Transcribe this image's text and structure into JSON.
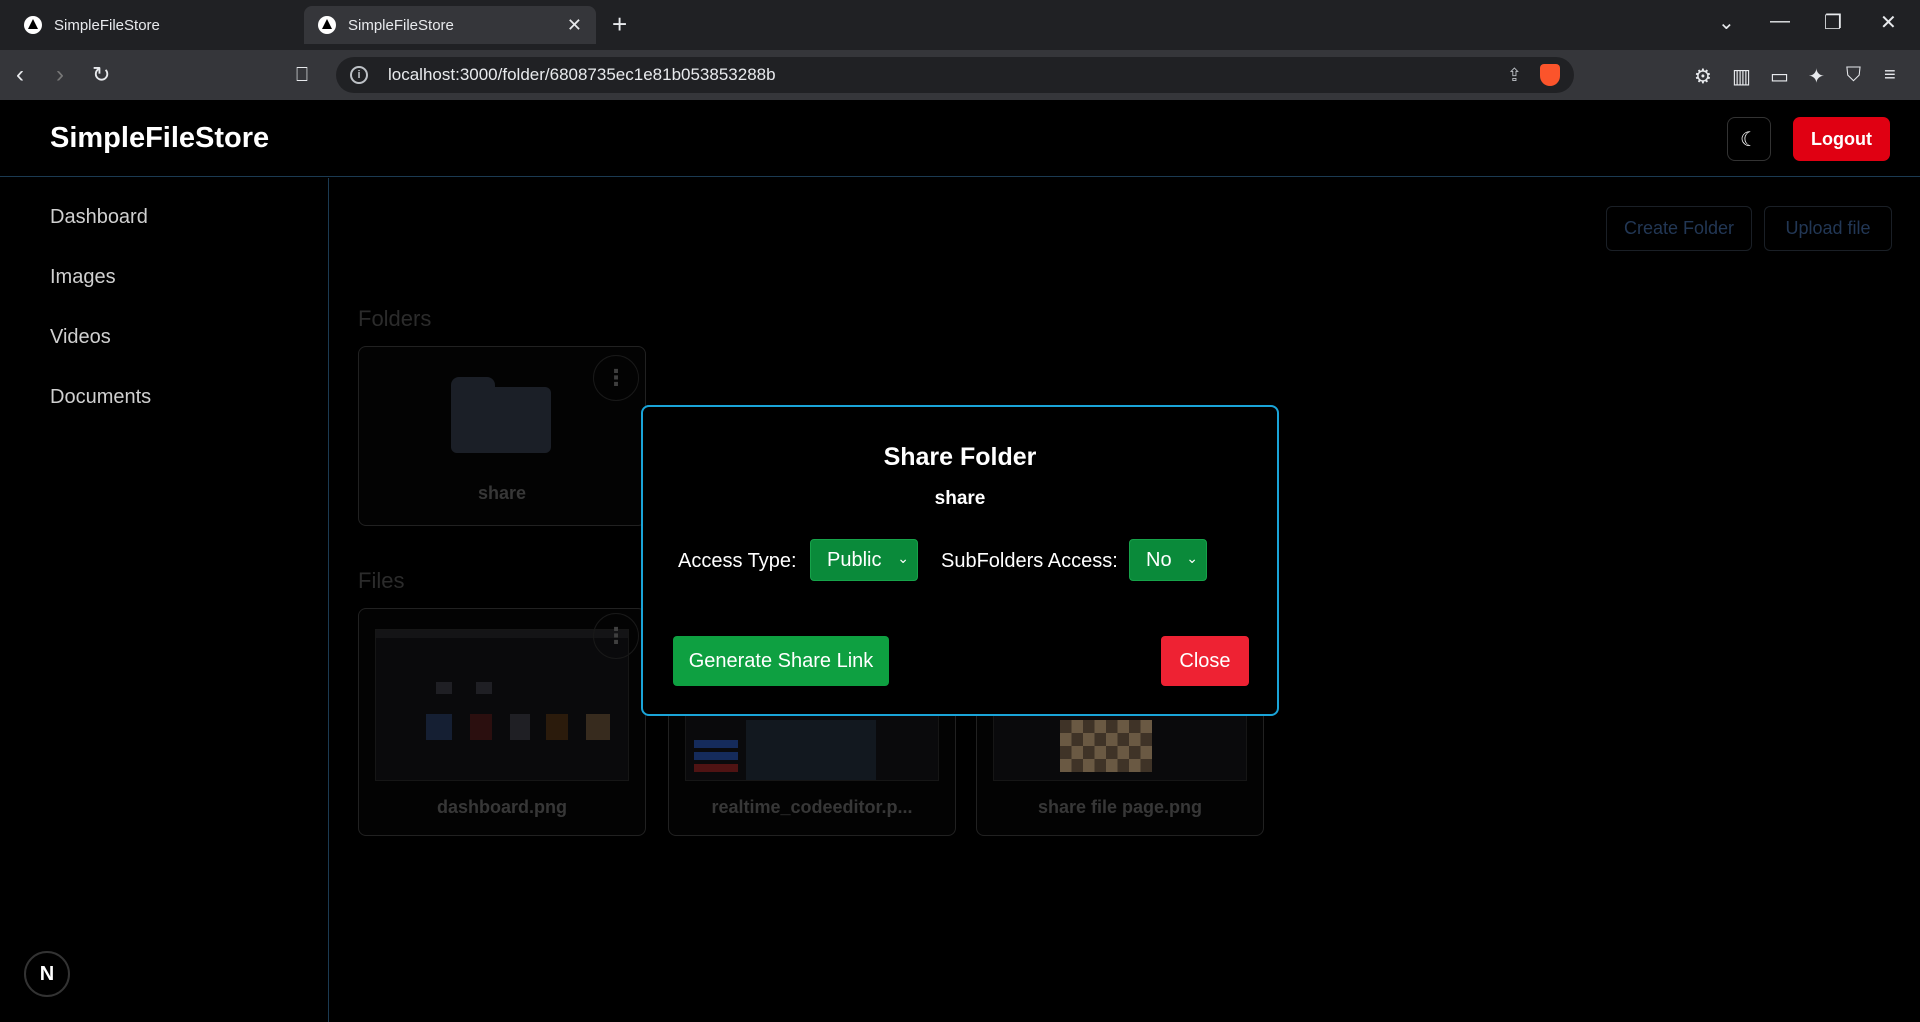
{
  "browser": {
    "tabs": [
      {
        "title": "SimpleFileStore"
      },
      {
        "title": "SimpleFileStore",
        "close": "✕"
      }
    ],
    "new_tab": "+",
    "url": "localhost:3000/folder/6808735ec1e81b053853288b"
  },
  "header": {
    "brand": "SimpleFileStore",
    "theme_icon": "☾",
    "logout_label": "Logout"
  },
  "sidebar": {
    "items": [
      {
        "label": "Dashboard"
      },
      {
        "label": "Images"
      },
      {
        "label": "Videos"
      },
      {
        "label": "Documents"
      }
    ]
  },
  "main": {
    "create_folder_label": "Create Folder",
    "upload_file_label": "Upload file",
    "folders_heading": "Folders",
    "files_heading": "Files",
    "folders": [
      {
        "name": "share"
      }
    ],
    "files": [
      {
        "name": "dashboard.png"
      },
      {
        "name": "realtime_codeeditor.p..."
      },
      {
        "name": "share file page.png"
      }
    ]
  },
  "modal": {
    "title": "Share Folder",
    "folder_name": "share",
    "access_type_label": "Access Type:",
    "access_type_value": "Public",
    "subfolders_label": "SubFolders Access:",
    "subfolders_value": "No",
    "generate_label": "Generate Share Link",
    "close_label": "Close"
  },
  "badge": "N",
  "colors": {
    "logout": "#e00012",
    "modal_border": "#1aa4d8",
    "green": "#0ea041",
    "close_red": "#ee2233"
  }
}
